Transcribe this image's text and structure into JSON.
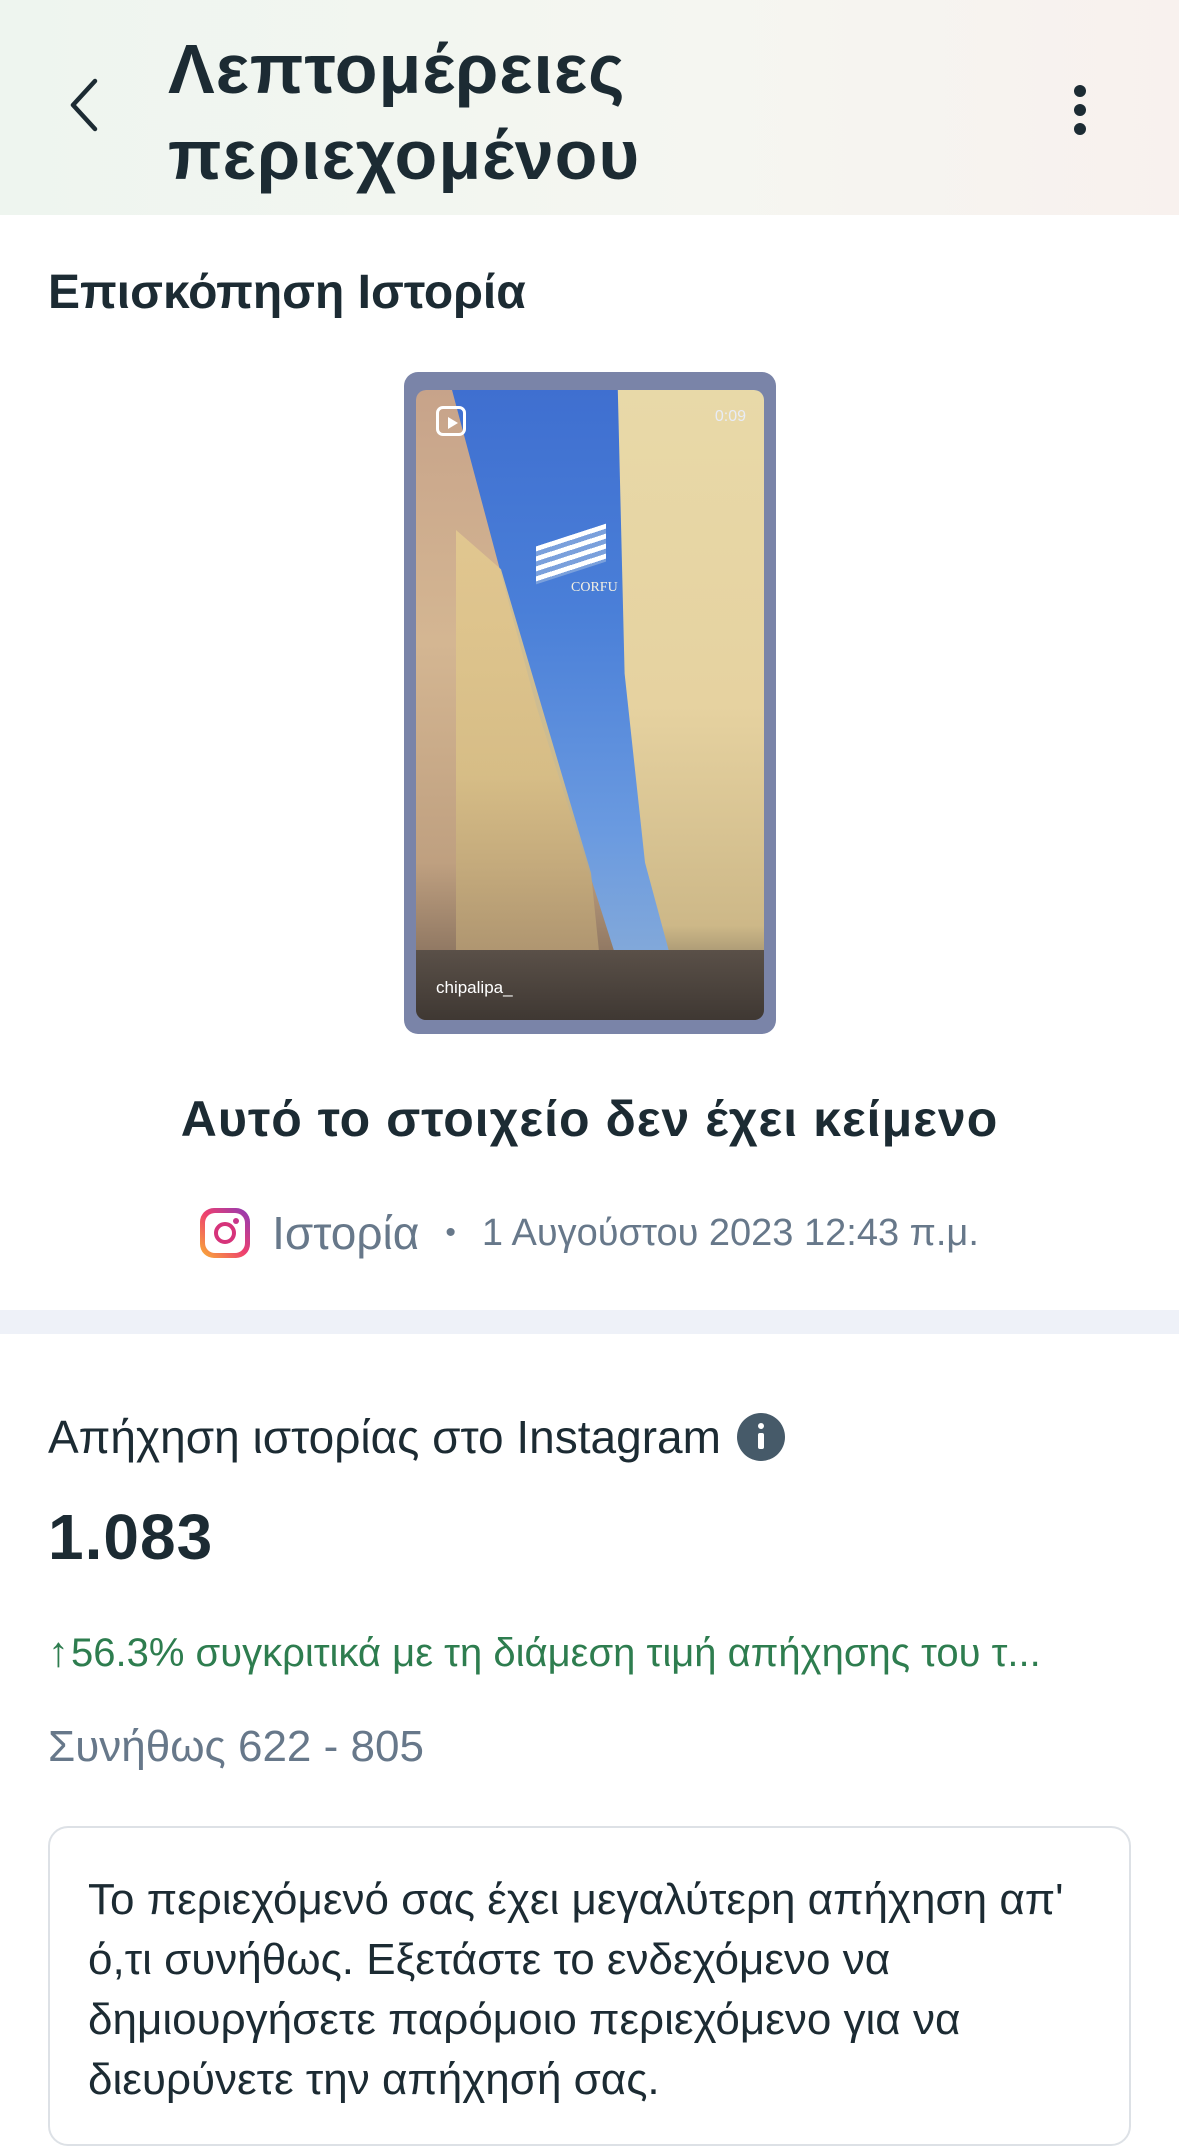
{
  "header": {
    "title": "Λεπτομέρειες περιεχομένου",
    "back_icon": "chevron-left-icon",
    "more_icon": "more-vertical-icon"
  },
  "preview_section": {
    "title": "Επισκόπηση Ιστορία",
    "thumbnail": {
      "duration": "0:09",
      "overlay_text": "CORFU",
      "username": "chipalipa_"
    },
    "caption": "Αυτό το στοιχείο δεν έχει κείμενο",
    "platform_icon": "instagram-icon",
    "type": "Ιστορία",
    "separator": "•",
    "date": "1 Αυγούστου 2023 12:43 π.μ."
  },
  "reach": {
    "label": "Απήχηση ιστορίας στο Instagram",
    "value": "1.083",
    "comparison_arrow": "↑",
    "comparison": "56.3% συγκριτικά με τη διάμεση τιμή απήχησης του τ...",
    "usual_range": "Συνήθως 622 - 805",
    "note": "Το περιεχόμενό σας έχει μεγαλύτερη απήχηση απ' ό,τι συνήθως. Εξετάστε το ενδεχόμενο να δημιουργήσετε παρόμοιο περιεχόμενο για να διευρύνετε την απήχησή σας."
  },
  "colors": {
    "text_primary": "#1c2b33",
    "text_secondary": "#67788a",
    "positive": "#2e7d4f",
    "divider": "#eef1f8"
  }
}
